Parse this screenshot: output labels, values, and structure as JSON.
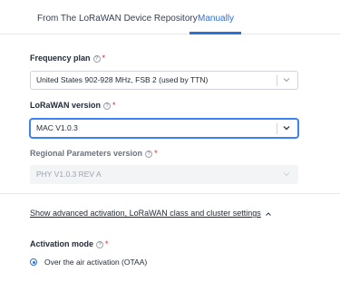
{
  "tabs": [
    {
      "label": "From The LoRaWAN Device Repository",
      "active": false
    },
    {
      "label": "Manually",
      "active": true
    }
  ],
  "colors": {
    "accent": "#2f6fd6",
    "required": "#dc2626"
  },
  "fields": {
    "frequency_plan": {
      "label": "Frequency plan",
      "required_mark": "*",
      "value": "United States 902-928 MHz, FSB 2 (used by TTN)"
    },
    "lorawan_version": {
      "label": "LoRaWAN version",
      "required_mark": "*",
      "value": "MAC V1.0.3"
    },
    "regional_params": {
      "label": "Regional Parameters version",
      "required_mark": "*",
      "value": "PHY V1.0.3 REV A",
      "disabled": true
    }
  },
  "advanced_link": "Show advanced activation, LoRaWAN class and cluster settings",
  "activation_mode": {
    "label": "Activation mode",
    "required_mark": "*",
    "options": [
      {
        "label": "Over the air activation (OTAA)",
        "selected": true
      }
    ]
  }
}
